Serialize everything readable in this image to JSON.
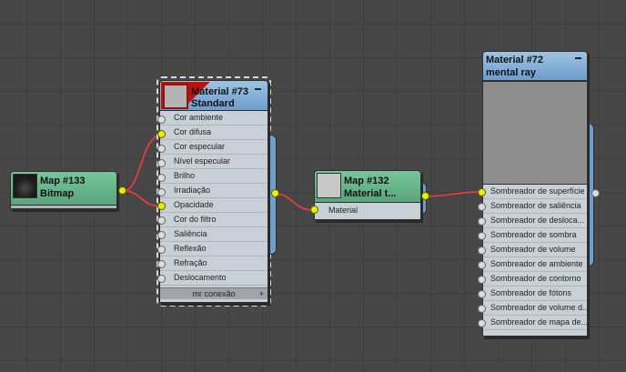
{
  "nodes": {
    "map133": {
      "title": "Map #133",
      "subtitle": "Bitmap"
    },
    "mat73": {
      "title": "Material #73",
      "subtitle": "Standard",
      "slots": [
        "Cor ambiente",
        "Cor difusa",
        "Cor especular",
        "Nível especular",
        "Brilho",
        "Irradiação",
        "Opacidade",
        "Cor do filtro",
        "Saliência",
        "Reflexão",
        "Refração",
        "Deslocamento"
      ],
      "footer": "mr conexão"
    },
    "map132": {
      "title": "Map #132",
      "subtitle": "Material t...",
      "slots": [
        "Material"
      ]
    },
    "mat72": {
      "title": "Material #72",
      "subtitle": "mental ray",
      "slots": [
        "Sombreador de superfície",
        "Sombreador de saliência",
        "Sombreador de desloca...",
        "Sombreador de sombra",
        "Sombreador de volume",
        "Sombreador de ambiente",
        "Sombreador de contorno",
        "Sombreador de fótons",
        "Sombreador de volume d...",
        "Sombreador de mapa de..."
      ]
    }
  },
  "colors": {
    "wire": "#ff3a3a",
    "socket_active": "#e6f000",
    "canvas": "#474747"
  }
}
